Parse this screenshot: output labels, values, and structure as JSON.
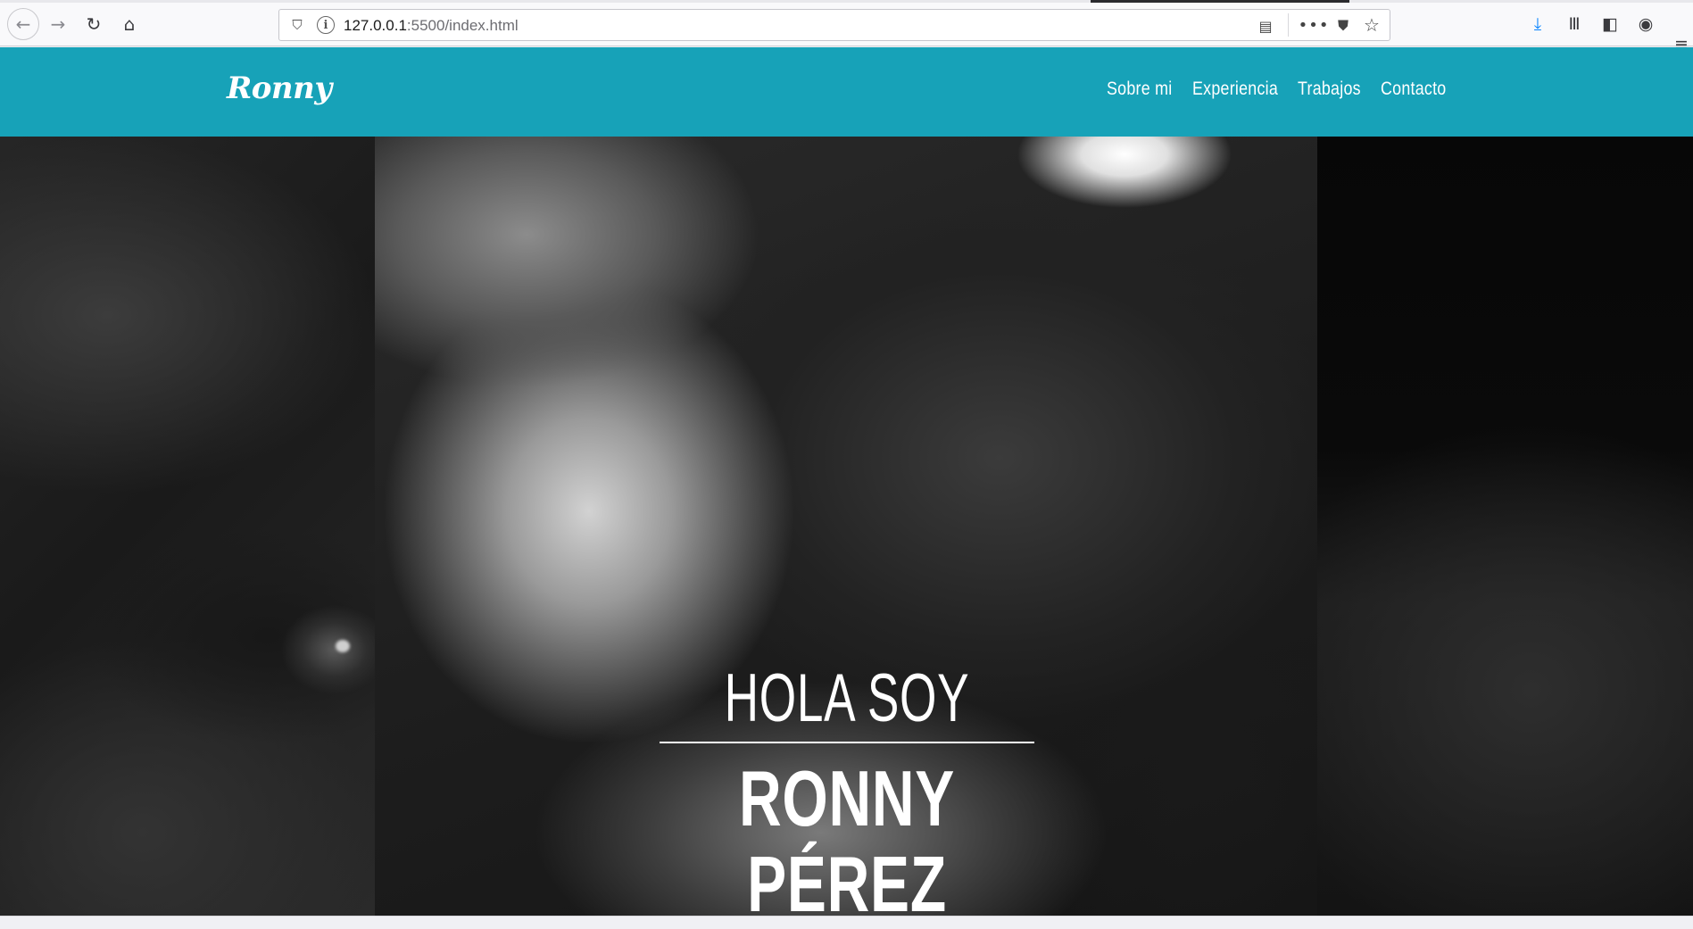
{
  "browser": {
    "url_host": "127.0.0.1",
    "url_rest": ":5500/index.html",
    "icons": {
      "back": "←",
      "forward": "→",
      "reload": "↻",
      "home": "⌂",
      "shield": "⛉",
      "info": "i",
      "reader": "▤",
      "more": "•••",
      "pocket": "⛊",
      "star": "☆",
      "download": "⤓",
      "library": "Ⅲ",
      "sidebar": "◧",
      "account": "◉",
      "menu": "≡"
    }
  },
  "site": {
    "logo": "Ronny",
    "nav": [
      "Sobre mi",
      "Experiencia",
      "Trabajos",
      "Contacto"
    ],
    "hero": {
      "greeting": "HOLA SOY",
      "name": "RONNY PÉREZ"
    },
    "colors": {
      "navbar": "#17a2b8",
      "text": "#ffffff"
    }
  }
}
